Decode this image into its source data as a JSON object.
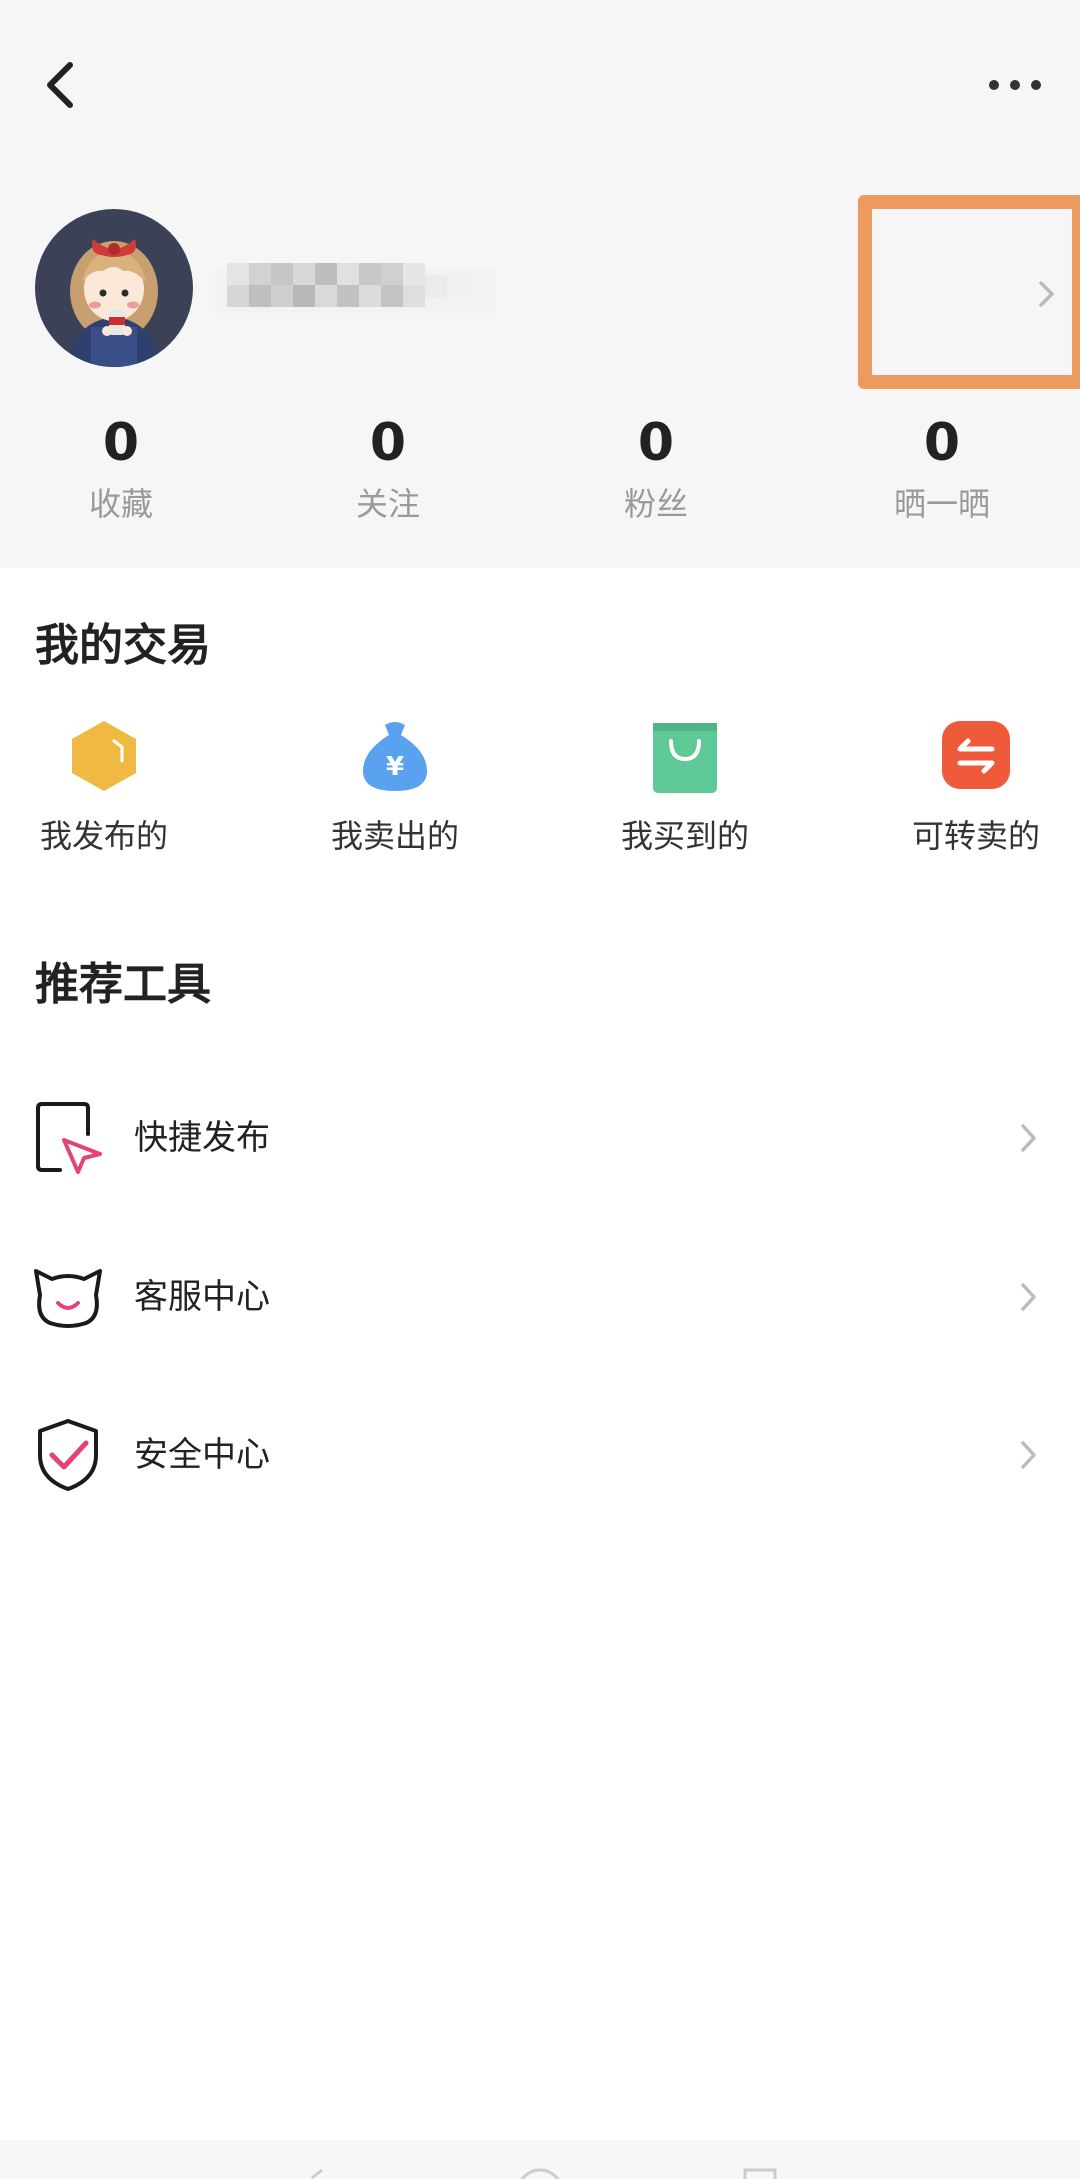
{
  "header": {
    "back_icon": "chevron-left-icon",
    "more_icon": "more-horizontal-icon"
  },
  "profile": {
    "avatar_icon": "avatar-illustration",
    "username_obscured": true
  },
  "stats": [
    {
      "value": "0",
      "label": "收藏"
    },
    {
      "value": "0",
      "label": "关注"
    },
    {
      "value": "0",
      "label": "粉丝"
    },
    {
      "value": "0",
      "label": "晒一晒"
    }
  ],
  "trades": {
    "title": "我的交易",
    "items": [
      {
        "label": "我发布的",
        "icon": "box-icon",
        "color": "#f0b942"
      },
      {
        "label": "我卖出的",
        "icon": "money-bag-icon",
        "color": "#5aa2f0"
      },
      {
        "label": "我买到的",
        "icon": "shopping-bag-icon",
        "color": "#5ec994"
      },
      {
        "label": "可转卖的",
        "icon": "transfer-icon",
        "color": "#ef5a3a"
      }
    ]
  },
  "tools": {
    "title": "推荐工具",
    "items": [
      {
        "label": "快捷发布",
        "icon": "quick-publish-icon"
      },
      {
        "label": "客服中心",
        "icon": "customer-service-cat-icon"
      },
      {
        "label": "安全中心",
        "icon": "security-shield-icon"
      }
    ]
  },
  "colors": {
    "accent": "#e6427a",
    "highlight_border": "#ec9a5e",
    "header_bg": "#f6f6f6"
  }
}
